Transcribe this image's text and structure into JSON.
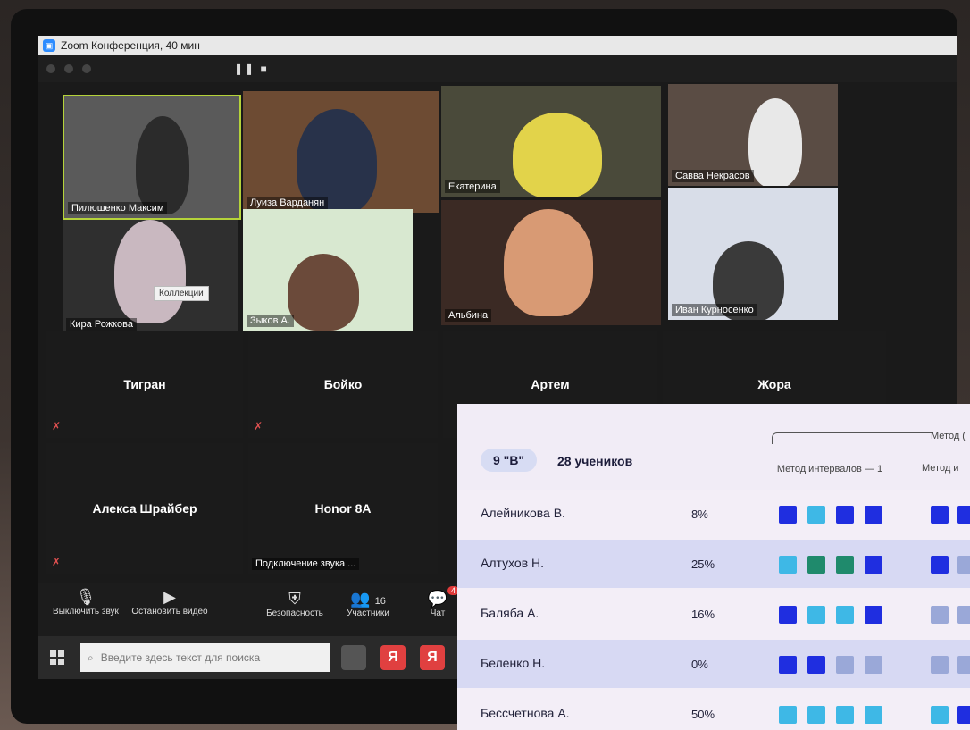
{
  "window": {
    "title": "Zoom Конференция, 40 мин"
  },
  "participants": [
    {
      "name": "Пилюшенко Максим",
      "video": true
    },
    {
      "name": "Луиза Варданян",
      "video": true
    },
    {
      "name": "Екатерина",
      "video": true
    },
    {
      "name": "Савва Некрасов",
      "video": true
    },
    {
      "name": "Кира Рожкова",
      "video": true
    },
    {
      "name": "Зыков А.",
      "video": true
    },
    {
      "name": "Альбина",
      "video": true
    },
    {
      "name": "Иван Курносенко",
      "video": true
    },
    {
      "name": "Тигран",
      "video": false
    },
    {
      "name": "Бойко",
      "video": false
    },
    {
      "name": "Артем",
      "video": false
    },
    {
      "name": "Жора",
      "video": false
    },
    {
      "name": "Алекса Шрайбер",
      "video": false
    },
    {
      "name": "Honor 8A",
      "video": false
    }
  ],
  "tooltip": "Коллекции",
  "audio_connecting": "Подключение звука ...",
  "toolbar": {
    "mute_label": "Выключить звук",
    "video_label": "Остановить видео",
    "security_label": "Безопасность",
    "participants_label": "Участники",
    "participants_count": "16",
    "chat_label": "Чат",
    "chat_badge": "4"
  },
  "taskbar": {
    "search_placeholder": "Введите здесь текст для поиска",
    "yandex_label": "Я"
  },
  "report": {
    "class_label": "9 \"В\"",
    "students_count": "28 учеников",
    "method_group_label": "Метод (",
    "method1_label": "Метод интервалов — 1",
    "method2_label": "Метод и",
    "students": [
      {
        "name": "Алейникова В.",
        "percent": "8%"
      },
      {
        "name": "Алтухов Н.",
        "percent": "25%"
      },
      {
        "name": "Баляба А.",
        "percent": "16%"
      },
      {
        "name": "Беленко Н.",
        "percent": "0%"
      },
      {
        "name": "Бессчетнова А.",
        "percent": "50%"
      }
    ]
  },
  "colors": {
    "zoom_blue": "#2d8cff",
    "active_speaker": "#b5d33a",
    "square_blue": "#1f2ee0",
    "square_cyan": "#3eb8e6",
    "square_green": "#1f8a6c",
    "square_grey": "#9aa8d8",
    "row_highlight": "#d7d9f3"
  }
}
